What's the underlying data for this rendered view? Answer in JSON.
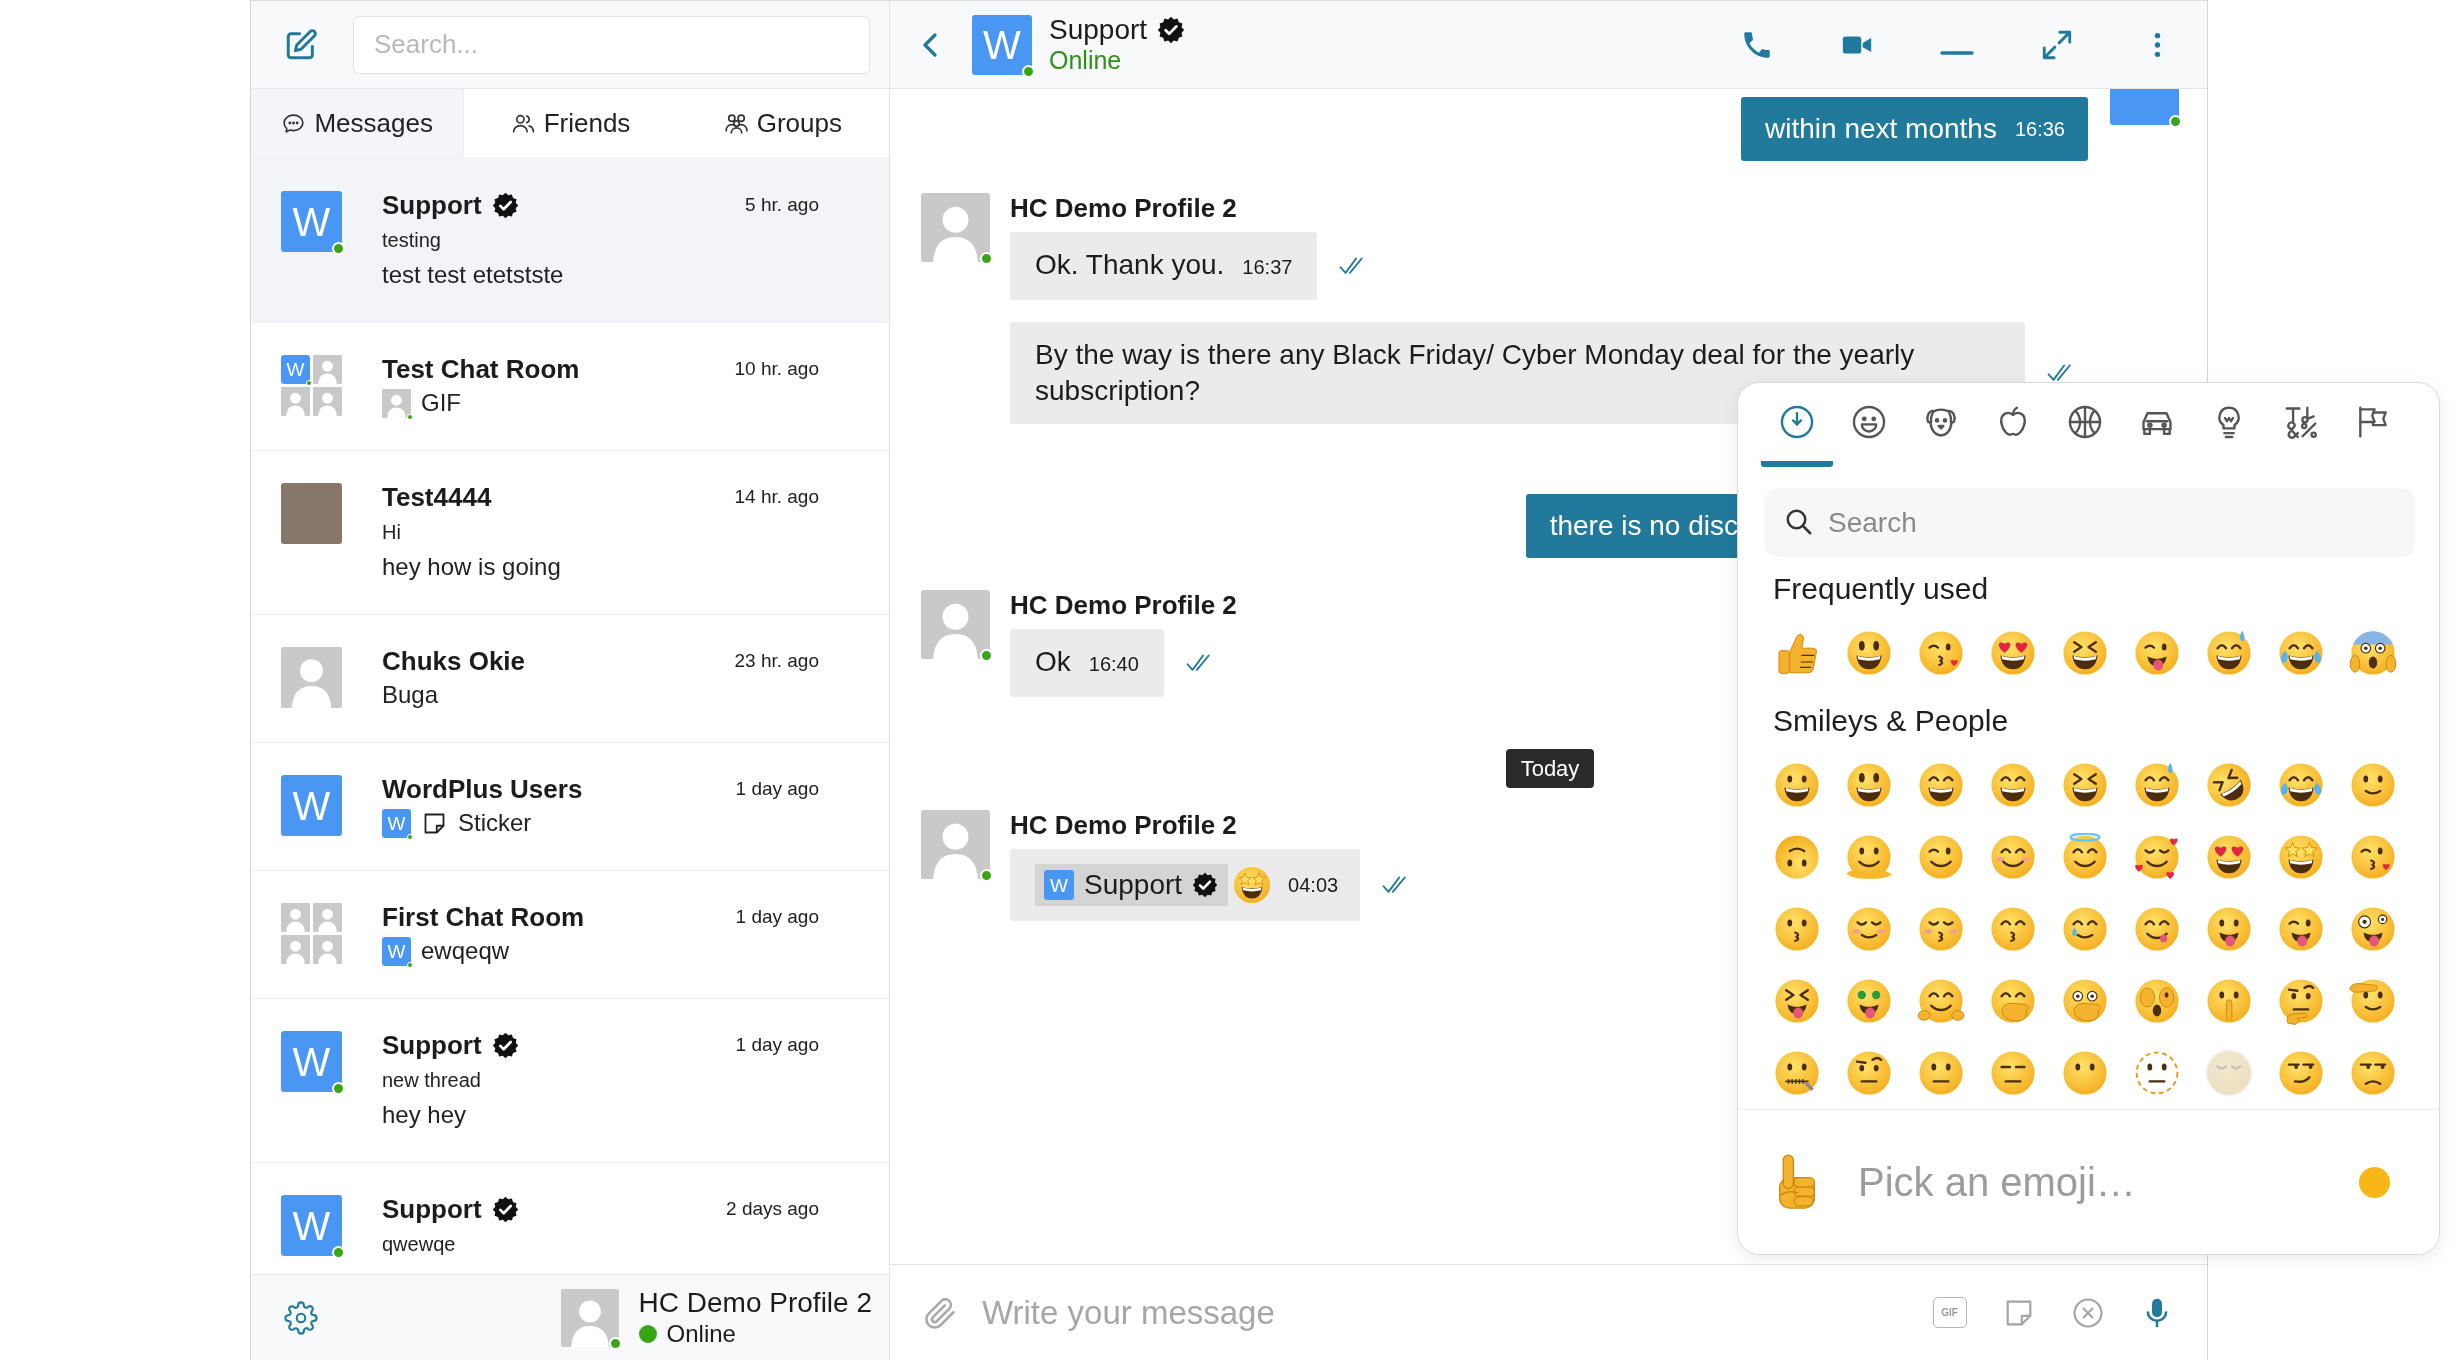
{
  "sidebar": {
    "search": {
      "placeholder": "Search..."
    },
    "tabs": [
      {
        "kind": "messages",
        "label": "Messages",
        "selected": true
      },
      {
        "kind": "friends",
        "label": "Friends",
        "selected": false
      },
      {
        "kind": "groups",
        "label": "Groups",
        "selected": false
      }
    ],
    "conversations": [
      {
        "avatar": {
          "kind": "tile",
          "letter": "W",
          "online": true
        },
        "name": "Support",
        "verified": true,
        "time": "5 hr. ago",
        "subject": "testing",
        "preview": "test test etetstste",
        "selected": true
      },
      {
        "avatar": {
          "kind": "group",
          "tiles": [
            {
              "kind": "tile",
              "letter": "W",
              "online": true
            },
            {
              "kind": "person",
              "online": false
            },
            {
              "kind": "person",
              "online": false
            },
            {
              "kind": "person",
              "online": false
            }
          ]
        },
        "name": "Test Chat Room",
        "verified": false,
        "time": "10 hr. ago",
        "sender": {
          "kind": "person",
          "online": true
        },
        "preview": "GIF",
        "selected": false
      },
      {
        "avatar": {
          "kind": "photo",
          "online": false
        },
        "name": "Test4444",
        "verified": false,
        "time": "14 hr. ago",
        "subject": "Hi",
        "preview": "hey how is going",
        "selected": false
      },
      {
        "avatar": {
          "kind": "person",
          "online": false
        },
        "name": "Chuks Okie",
        "verified": false,
        "time": "23 hr. ago",
        "preview": "Buga",
        "selected": false
      },
      {
        "avatar": {
          "kind": "tile",
          "letter": "W",
          "online": false
        },
        "name": "WordPlus Users",
        "verified": false,
        "time": "1 day ago",
        "sender": {
          "kind": "tile",
          "letter": "W",
          "online": true
        },
        "attachment": {
          "kind": "sticker"
        },
        "preview": "Sticker",
        "selected": false
      },
      {
        "avatar": {
          "kind": "group",
          "tiles": [
            {
              "kind": "person",
              "online": false
            },
            {
              "kind": "person",
              "online": false
            },
            {
              "kind": "person",
              "online": false
            },
            {
              "kind": "person",
              "online": false
            }
          ]
        },
        "name": "First Chat Room",
        "verified": false,
        "time": "1 day ago",
        "sender": {
          "kind": "tile",
          "letter": "W",
          "online": true
        },
        "preview": "ewqeqw",
        "selected": false
      },
      {
        "avatar": {
          "kind": "tile",
          "letter": "W",
          "online": true
        },
        "name": "Support",
        "verified": true,
        "time": "1 day ago",
        "subject": "new thread",
        "preview": "hey hey",
        "selected": false
      },
      {
        "avatar": {
          "kind": "tile",
          "letter": "W",
          "online": true
        },
        "name": "Support",
        "verified": true,
        "time": "2 days ago",
        "subject": "qwewqe",
        "selected": false
      }
    ],
    "profile": {
      "avatar": {
        "kind": "person",
        "online": true
      },
      "name": "HC Demo Profile 2",
      "online": true,
      "status": "Online"
    }
  },
  "chat": {
    "header": {
      "avatar": {
        "kind": "tile",
        "letter": "W",
        "online": true
      },
      "name": "Support",
      "verified": true,
      "status": "Online"
    },
    "messages": [
      {
        "kind": "outgoing",
        "avatar": {
          "kind": "tile",
          "online": true
        },
        "text": "within next months",
        "time": "16:36"
      },
      {
        "kind": "incoming",
        "sender": "HC Demo Profile 2",
        "avatar": {
          "kind": "person",
          "online": true
        },
        "bubbles": [
          {
            "kind": "text",
            "text": "Ok. Thank you.",
            "time": "16:37",
            "read": true
          },
          {
            "kind": "text",
            "text": "By the way is there any Black Friday/ Cyber Monday deal for the yearly subscription?",
            "read": true
          }
        ]
      },
      {
        "kind": "outgoing",
        "text": "there is no disc"
      },
      {
        "kind": "incoming",
        "sender": "HC Demo Profile 2",
        "avatar": {
          "kind": "person",
          "online": true
        },
        "bubbles": [
          {
            "kind": "text",
            "text": "Ok",
            "time": "16:40",
            "read": true
          }
        ]
      },
      {
        "kind": "date",
        "text": "Today"
      },
      {
        "kind": "incoming",
        "sender": "HC Demo Profile 2",
        "avatar": {
          "kind": "person",
          "online": true
        },
        "bubbles": [
          {
            "kind": "mention",
            "mention": {
              "avatar": {
                "kind": "tile",
                "letter": "W",
                "online": false
              },
              "name": "Support",
              "verified": true
            },
            "time": "04:03",
            "read": true
          }
        ]
      }
    ],
    "composer": {
      "placeholder": "Write your message",
      "gif_button": "GIF"
    }
  },
  "emoji_picker": {
    "categories": [
      {
        "kind": "recent",
        "selected": true
      },
      {
        "kind": "smileys",
        "selected": false
      },
      {
        "kind": "animals",
        "selected": false
      },
      {
        "kind": "food",
        "selected": false
      },
      {
        "kind": "activities",
        "selected": false
      },
      {
        "kind": "travel",
        "selected": false
      },
      {
        "kind": "objects",
        "selected": false
      },
      {
        "kind": "symbols",
        "selected": false
      },
      {
        "kind": "flags",
        "selected": false
      }
    ],
    "search": {
      "placeholder": "Search"
    },
    "sections": [
      {
        "kind": "frequent",
        "title": "Frequently used"
      },
      {
        "kind": "smileys",
        "title": "Smileys & People"
      }
    ],
    "preview": "Pick an emoji…"
  }
}
